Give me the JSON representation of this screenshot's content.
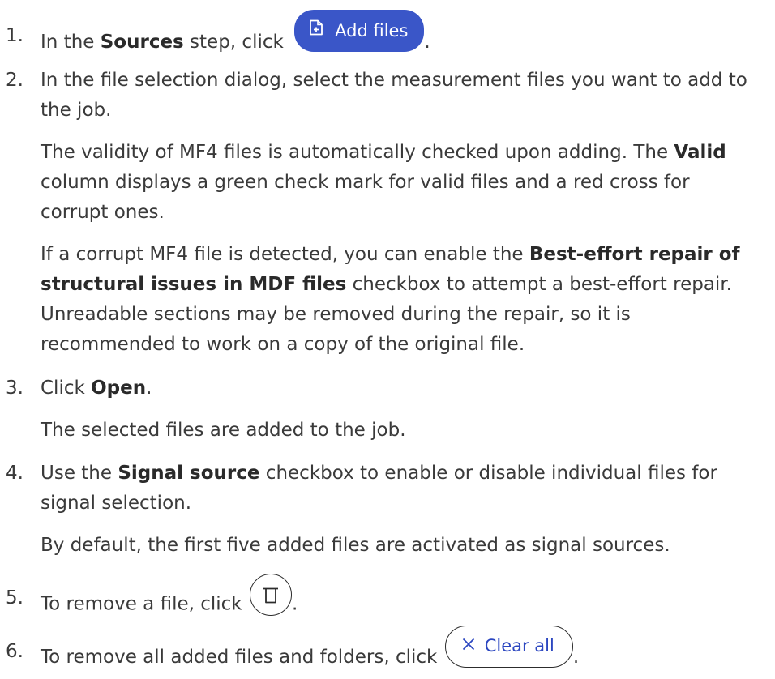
{
  "steps": [
    {
      "number": "1.",
      "pre": "In the ",
      "bold": "Sources",
      "mid": " step, click ",
      "button": "Add files",
      "button_icon": "add-file-icon",
      "end": "."
    },
    {
      "number": "2.",
      "text": "In the file selection dialog, select the measurement files you want to add to the job.",
      "para2_pre": "The validity of MF4 files is automatically checked upon adding. The ",
      "para2_bold": "Valid",
      "para2_post": " column displays a green check mark for valid files and a red cross for corrupt ones.",
      "para3_pre": "If a corrupt MF4 file is detected, you can enable the ",
      "para3_bold": "Best-effort repair of structural issues in MDF files",
      "para3_post": " checkbox to attempt a best-effort repair. Unreadable sections may be removed during the repair, so it is recommended to work on a copy of the original file."
    },
    {
      "number": "3.",
      "pre": "Click ",
      "bold": "Open",
      "end": ".",
      "result": "The selected files are added to the job."
    },
    {
      "number": "4.",
      "pre": "Use the ",
      "bold": "Signal source",
      "post": " checkbox to enable or disable individual files for signal selection.",
      "result": "By default, the first five added files are activated as signal sources."
    },
    {
      "number": "5.",
      "text": "To remove a file, click ",
      "button_icon": "trash-icon",
      "end": "."
    },
    {
      "number": "6.",
      "text": "To remove all added files and folders, click ",
      "button": "Clear all",
      "button_icon": "close-icon",
      "end": "."
    }
  ],
  "colors": {
    "text": "#3a3a3a",
    "primary_button": "#3a56c8",
    "outline_button_text": "#2b46c0"
  }
}
